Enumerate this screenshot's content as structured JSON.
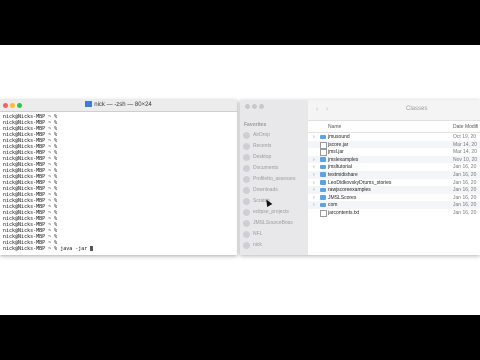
{
  "terminal": {
    "title": "nick — -zsh — 80×24",
    "prompt_lines": [
      "nick@Nicks-MBP ~ %",
      "nick@Nicks-MBP ~ %",
      "nick@Nicks-MBP ~ %",
      "nick@Nicks-MBP ~ %",
      "nick@Nicks-MBP ~ %",
      "nick@Nicks-MBP ~ %",
      "nick@Nicks-MBP ~ %",
      "nick@Nicks-MBP ~ %",
      "nick@Nicks-MBP ~ %",
      "nick@Nicks-MBP ~ %",
      "nick@Nicks-MBP ~ %",
      "nick@Nicks-MBP ~ %",
      "nick@Nicks-MBP ~ %",
      "nick@Nicks-MBP ~ %",
      "nick@Nicks-MBP ~ %",
      "nick@Nicks-MBP ~ %",
      "nick@Nicks-MBP ~ %",
      "nick@Nicks-MBP ~ %",
      "nick@Nicks-MBP ~ %",
      "nick@Nicks-MBP ~ %",
      "nick@Nicks-MBP ~ %",
      "nick@Nicks-MBP ~ %"
    ],
    "current_command": "nick@Nicks-MBP ~ % java -jar "
  },
  "finder": {
    "title": "Classes",
    "sidebar_section": "Favorites",
    "sidebar_items": [
      "AirDrop",
      "Recents",
      "Desktop",
      "Documents",
      "Profiletto_assesors",
      "Downloads",
      "Scratch",
      "eclipse_projects",
      "JMSLSourceBoss",
      "NFL",
      "nick"
    ],
    "columns": {
      "name": "Name",
      "date": "Date Modifi"
    },
    "rows": [
      {
        "name": "jmusound",
        "date": "Oct 19, 20",
        "type": "folder",
        "expandable": true
      },
      {
        "name": "jscore.jar",
        "date": "Mar 14, 20",
        "type": "file",
        "expandable": false
      },
      {
        "name": "jmsl.jar",
        "date": "Mar 14, 20",
        "type": "file",
        "expandable": false
      },
      {
        "name": "jmslexamples",
        "date": "Nov 10, 20",
        "type": "folder",
        "expandable": true
      },
      {
        "name": "jmsltutorial",
        "date": "Jan 16, 20",
        "type": "folder",
        "expandable": true
      },
      {
        "name": "testmidishare",
        "date": "Jan 16, 20",
        "type": "folder",
        "expandable": true
      },
      {
        "name": "LeoDidkovskyDrums_stories",
        "date": "Jan 16, 20",
        "type": "folder",
        "expandable": true
      },
      {
        "name": "rawjscoreexamples",
        "date": "Jan 16, 20",
        "type": "folder",
        "expandable": true
      },
      {
        "name": "JMSLScores",
        "date": "Jan 16, 20",
        "type": "folder",
        "expandable": true
      },
      {
        "name": "com",
        "date": "Jan 16, 20",
        "type": "folder",
        "expandable": true
      },
      {
        "name": "jarcontents.txt",
        "date": "Jan 16, 20",
        "type": "file",
        "expandable": false
      }
    ]
  },
  "colors": {
    "folder": "#5aa3e6",
    "sidebar_bg": "#e8e8ea",
    "close": "#ff5f57",
    "minimize": "#febc2e",
    "zoom": "#28c840"
  }
}
